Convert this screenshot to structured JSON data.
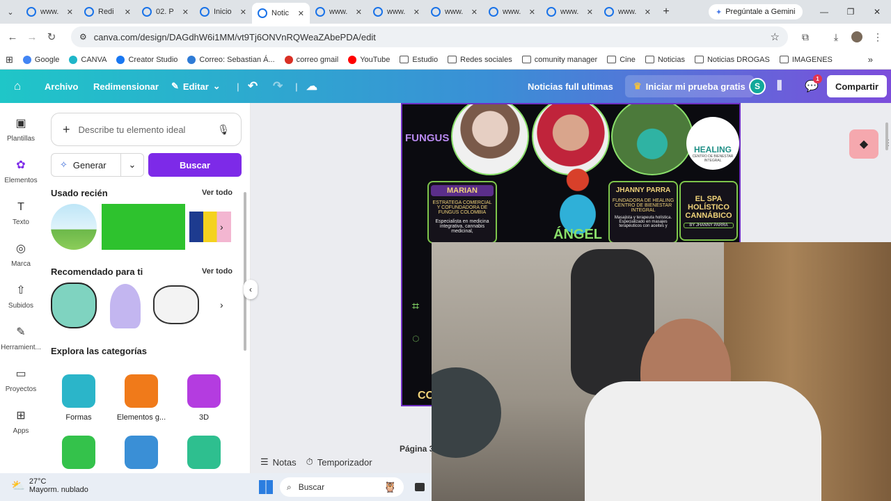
{
  "browser": {
    "tabs": [
      {
        "title": "www."
      },
      {
        "title": "Redi"
      },
      {
        "title": "02. P"
      },
      {
        "title": "Inicio"
      },
      {
        "title": "Notic",
        "active": true
      },
      {
        "title": "www."
      },
      {
        "title": "www."
      },
      {
        "title": "www."
      },
      {
        "title": "www."
      },
      {
        "title": "www."
      },
      {
        "title": "www."
      }
    ],
    "gemini_label": "Pregúntale a Gemini",
    "url": "canva.com/design/DAGdhW6i1MM/vt9Tj6ONVnRQWeaZAbePDA/edit",
    "bookmarks": [
      {
        "label": "Google"
      },
      {
        "label": "CANVA"
      },
      {
        "label": "Creator Studio"
      },
      {
        "label": "Correo: Sebastian Á..."
      },
      {
        "label": "correo gmail"
      },
      {
        "label": "YouTube"
      },
      {
        "label": "Estudio"
      },
      {
        "label": "Redes sociales"
      },
      {
        "label": "comunity manager"
      },
      {
        "label": "Cine"
      },
      {
        "label": "Noticias"
      },
      {
        "label": "Noticias DROGAS"
      },
      {
        "label": "IMAGENES"
      }
    ]
  },
  "canva": {
    "archivo": "Archivo",
    "redimensionar": "Redimensionar",
    "editar": "Editar",
    "doc_title": "Noticias full  ultimas",
    "trial": "Iniciar mi prueba gratis",
    "avatar_letter": "S",
    "notif_count": "1",
    "share": "Compartir"
  },
  "rail": [
    {
      "label": "Plantillas"
    },
    {
      "label": "Elementos"
    },
    {
      "label": "Texto"
    },
    {
      "label": "Marca"
    },
    {
      "label": "Subidos"
    },
    {
      "label": "Herramient..."
    },
    {
      "label": "Proyectos"
    },
    {
      "label": "Apps"
    }
  ],
  "panel": {
    "search_placeholder": "Describe tu elemento ideal",
    "generar": "Generar",
    "buscar": "Buscar",
    "recent_title": "Usado recién",
    "recommended_title": "Recomendado para ti",
    "see_all": "Ver todo",
    "categories_title": "Explora las categorías",
    "categories": [
      {
        "label": "Formas",
        "color": "#2bb5c9"
      },
      {
        "label": "Elementos g...",
        "color": "#f07a1a"
      },
      {
        "label": "3D",
        "color": "#b43ce0"
      },
      {
        "label": "",
        "color": "#34c24b"
      },
      {
        "label": "",
        "color": "#3a8fd6"
      },
      {
        "label": "",
        "color": "#2ebf8f"
      }
    ]
  },
  "design": {
    "brand_left": "FUNGUS",
    "name_left": "MARIAN",
    "role_left": "ESTRATEGA COMERCIAL Y COFUNDADORA DE FUNGUS COLOMBIA",
    "desc_left": "Especialista en medicina integrativa, cannabis medicinal,",
    "center_name": "ÁNGEL",
    "name_right": "JHANNY PARRA",
    "role_right": "FUNDADORA DE HEALING CENTRO DE BIENESTAR INTEGRAL",
    "desc_right": "Masajista y terapeuta holística. Especializado en masajes terapéuticos con aceites y",
    "spa": "EL SPA HOLÍSTICO CANNÁBICO",
    "spa_by": "BY JHANNY PARRA",
    "healing": "HEALING",
    "healing_sub": "CENTRO DE BIENESTAR INTEGRAL",
    "footer_partial": "CO"
  },
  "stage": {
    "page_label": "Página 3",
    "notas": "Notas",
    "temporizador": "Temporizador"
  },
  "taskbar": {
    "temp": "27°C",
    "weather": "Mayorm. nublado",
    "search": "Buscar"
  },
  "colors": {
    "canva_purple": "#7d2ae8",
    "header_start": "#1fc6c8",
    "header_end": "#7c4ddb"
  }
}
